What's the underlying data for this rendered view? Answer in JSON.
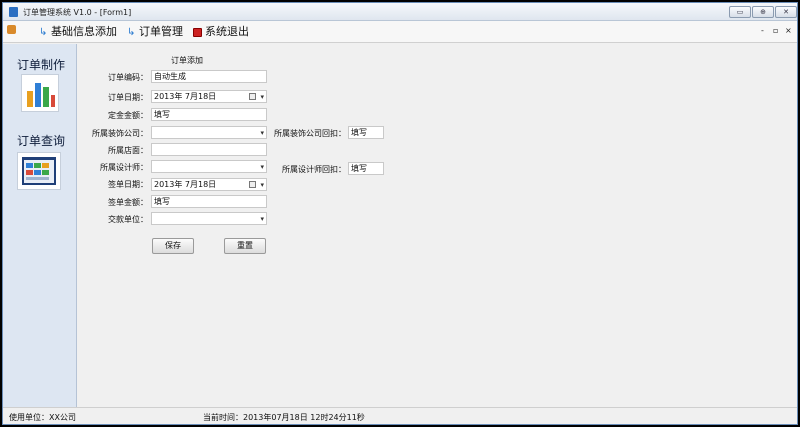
{
  "window": {
    "title": "订单管理系统 V1.0 - [Form1]",
    "controls": [
      "▭",
      "⊕",
      "✕"
    ]
  },
  "menu": {
    "items": [
      {
        "label": "基础信息添加",
        "icon": "link-icon"
      },
      {
        "label": "订单管理",
        "icon": "link-icon"
      },
      {
        "label": "系统退出",
        "icon": "exit-icon"
      }
    ],
    "mdi_controls": [
      "-",
      "▫",
      "×"
    ]
  },
  "sidebar": {
    "items": [
      {
        "label": "订单制作",
        "icon": "bar-chart-icon"
      },
      {
        "label": "订单查询",
        "icon": "spreadsheet-icon"
      }
    ]
  },
  "form": {
    "heading": "订单添加",
    "order_no": {
      "label": "订单编码：",
      "value": "自动生成"
    },
    "order_date": {
      "label": "订单日期：",
      "value": "2013年 7月18日"
    },
    "deposit": {
      "label": "定金金额：",
      "value": "填写"
    },
    "decor_company": {
      "label": "所属装饰公司：",
      "value": ""
    },
    "decor_company_rebate": {
      "label": "所属装饰公司回扣：",
      "value": "填写"
    },
    "store": {
      "label": "所属店面：",
      "value": ""
    },
    "designer": {
      "label": "所属设计师：",
      "value": ""
    },
    "designer_rebate": {
      "label": "所属设计师回扣：",
      "value": "填写"
    },
    "sign_date": {
      "label": "签单日期：",
      "value": "2013年 7月18日"
    },
    "sign_amount": {
      "label": "签单金额：",
      "value": "填写"
    },
    "payer": {
      "label": "交款单位：",
      "value": ""
    },
    "save_label": "保存",
    "reset_label": "重置"
  },
  "status": {
    "unit": "使用单位：XX公司",
    "time": "当前时间：2013年07月18日 12时24分11秒"
  },
  "colors": {
    "sidebar_bg": "#dde6f2",
    "content_bg": "#f0f0f0",
    "title_icon": "#2b6fc2"
  }
}
